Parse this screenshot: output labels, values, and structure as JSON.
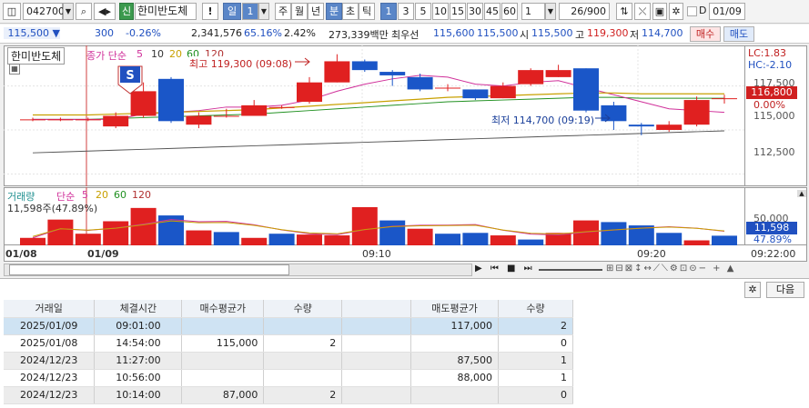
{
  "toolbar": {
    "code": "042700",
    "stock_badge": "신",
    "stock_name": "한미반도체",
    "warning": "!",
    "period_selected": "일",
    "period_value": "1",
    "periods": [
      "주",
      "월",
      "년",
      "분",
      "초",
      "틱"
    ],
    "minutes": [
      "1",
      "3",
      "5",
      "10",
      "15",
      "30",
      "45",
      "60"
    ],
    "interval_value": "1",
    "count": "26/900",
    "d_label": "D",
    "date": "01/09"
  },
  "info": {
    "price": "115,500 ▼",
    "change": "300",
    "change_pct": "-0.26%",
    "volume": "2,341,576",
    "vol_ratio": "65.16%",
    "turnover": "2.42%",
    "amount": "273,339백만",
    "best_label": "최우선",
    "best_ask": "115,600",
    "best_bid": "115,500",
    "open_label": "시",
    "open": "115,500",
    "high_label": "고",
    "high": "119,300",
    "low_label": "저",
    "low": "114,700",
    "buy": "매수",
    "sell": "매도"
  },
  "price_pane": {
    "name": "한미반도체",
    "indicator": "종가 단순",
    "ma": [
      "5",
      "10",
      "20",
      "60",
      "120"
    ],
    "ma_colors": [
      "#d0309a",
      "#333333",
      "#c8a000",
      "#209020",
      "#b03030"
    ],
    "signal": "S",
    "high_note": "최고 119,300 (09:08)",
    "low_note": "최저 114,700 (09:19)",
    "lc": "LC:1.83",
    "hc": "HC:-2.10",
    "current_price": "116,800",
    "pct": "0.00%",
    "ticks": [
      "117,500",
      "115,000",
      "112,500"
    ]
  },
  "volume_pane": {
    "title": "거래량",
    "indicator": "단순",
    "ma": [
      "5",
      "20",
      "60",
      "120"
    ],
    "current": "11,598주(47.89%)",
    "tick": "50,000",
    "current_tag": "11,598",
    "pct": "47.89%"
  },
  "x_axis": {
    "labels": [
      "01/08",
      "01/09",
      "09:10",
      "09:20"
    ],
    "time": "09:22:00"
  },
  "settings_next": "다음",
  "table": {
    "headers": [
      "거래일",
      "체결시간",
      "매수평균가",
      "수량",
      "",
      "매도평균가",
      "수량"
    ],
    "rows": [
      {
        "date": "2025/01/09",
        "time": "09:01:00",
        "buy_avg": "",
        "buy_qty": "",
        "sell_avg": "117,000",
        "sell_qty": "2"
      },
      {
        "date": "2025/01/08",
        "time": "14:54:00",
        "buy_avg": "115,000",
        "buy_qty": "2",
        "sell_avg": "",
        "sell_qty": "0"
      },
      {
        "date": "2024/12/23",
        "time": "11:27:00",
        "buy_avg": "",
        "buy_qty": "",
        "sell_avg": "87,500",
        "sell_qty": "1"
      },
      {
        "date": "2024/12/23",
        "time": "10:56:00",
        "buy_avg": "",
        "buy_qty": "",
        "sell_avg": "88,000",
        "sell_qty": "1"
      },
      {
        "date": "2024/12/23",
        "time": "10:14:00",
        "buy_avg": "87,000",
        "buy_qty": "2",
        "sell_avg": "",
        "sell_qty": "0"
      }
    ]
  },
  "chart_data": {
    "type": "candlestick",
    "candles": [
      {
        "o": 115600,
        "c": 115600,
        "h": 115700,
        "l": 115500
      },
      {
        "o": 115600,
        "c": 115600,
        "h": 115700,
        "l": 115500
      },
      {
        "o": 115600,
        "c": 115600,
        "h": 115700,
        "l": 115500
      },
      {
        "o": 115200,
        "c": 115800,
        "h": 116000,
        "l": 115100
      },
      {
        "o": 115800,
        "c": 117200,
        "h": 117700,
        "l": 115700
      },
      {
        "o": 117900,
        "c": 115500,
        "h": 118000,
        "l": 115400
      },
      {
        "o": 115300,
        "c": 115800,
        "h": 116000,
        "l": 115100
      },
      {
        "o": 115800,
        "c": 115800,
        "h": 116200,
        "l": 115700
      },
      {
        "o": 115800,
        "c": 116400,
        "h": 116700,
        "l": 115800
      },
      {
        "o": 116300,
        "c": 116300,
        "h": 116400,
        "l": 116200
      },
      {
        "o": 116600,
        "c": 117700,
        "h": 118000,
        "l": 116500
      },
      {
        "o": 117700,
        "c": 118900,
        "h": 119300,
        "l": 117700
      },
      {
        "o": 118900,
        "c": 118400,
        "h": 119000,
        "l": 118300
      },
      {
        "o": 118300,
        "c": 118100,
        "h": 118400,
        "l": 117500
      },
      {
        "o": 118000,
        "c": 117300,
        "h": 118200,
        "l": 117200
      },
      {
        "o": 117400,
        "c": 117400,
        "h": 117600,
        "l": 117200
      },
      {
        "o": 117300,
        "c": 116800,
        "h": 117300,
        "l": 116700
      },
      {
        "o": 116800,
        "c": 117500,
        "h": 117700,
        "l": 116800
      },
      {
        "o": 117600,
        "c": 118400,
        "h": 118500,
        "l": 117500
      },
      {
        "o": 118000,
        "c": 118400,
        "h": 118700,
        "l": 118000
      },
      {
        "o": 118500,
        "c": 116100,
        "h": 118500,
        "l": 116000
      },
      {
        "o": 116400,
        "c": 115500,
        "h": 116600,
        "l": 115000
      },
      {
        "o": 115300,
        "c": 115200,
        "h": 115400,
        "l": 114700
      },
      {
        "o": 115000,
        "c": 115300,
        "h": 115500,
        "l": 114900
      },
      {
        "o": 115300,
        "c": 116700,
        "h": 116900,
        "l": 115200
      },
      {
        "o": 116800,
        "c": 116800,
        "h": 117000,
        "l": 116500
      }
    ],
    "volume": [
      9000,
      31000,
      14000,
      29000,
      45000,
      36000,
      18000,
      16000,
      9000,
      14000,
      13000,
      12000,
      46000,
      30000,
      20000,
      14000,
      15000,
      12000,
      7000,
      15000,
      30000,
      28000,
      24000,
      15000,
      6000,
      11598
    ],
    "volume_up": [
      true,
      true,
      true,
      true,
      true,
      false,
      true,
      false,
      true,
      false,
      true,
      true,
      true,
      false,
      true,
      false,
      false,
      true,
      false,
      true,
      true,
      false,
      false,
      false,
      true,
      false
    ],
    "ma5_price": [
      115600,
      115600,
      115600,
      115600,
      115900,
      116000,
      116100,
      116300,
      116300,
      116400,
      116700,
      117200,
      117600,
      117900,
      118100,
      118000,
      117600,
      117500,
      117700,
      117800,
      117400,
      117000,
      116600,
      116200,
      116100,
      116000
    ],
    "ma_long_price": [
      115600,
      115600,
      115600,
      115650,
      115700,
      115750,
      115800,
      115850,
      115900,
      116000,
      116100,
      116200,
      116300,
      116400,
      116500,
      116600,
      116650,
      116700,
      116750,
      116800,
      116850,
      116850,
      116800,
      116800,
      116800,
      116800
    ],
    "trend_low": [
      113700,
      113750,
      113800,
      113850,
      113900,
      113950,
      114000,
      114050,
      114100,
      114150,
      114200,
      114250,
      114300,
      114350,
      114400,
      114450,
      114500,
      114550,
      114600,
      114650,
      114700,
      114750,
      114800,
      114850,
      114900,
      114950
    ],
    "ylim": [
      111800,
      119800
    ],
    "vol_ylim": [
      0,
      70000
    ]
  }
}
